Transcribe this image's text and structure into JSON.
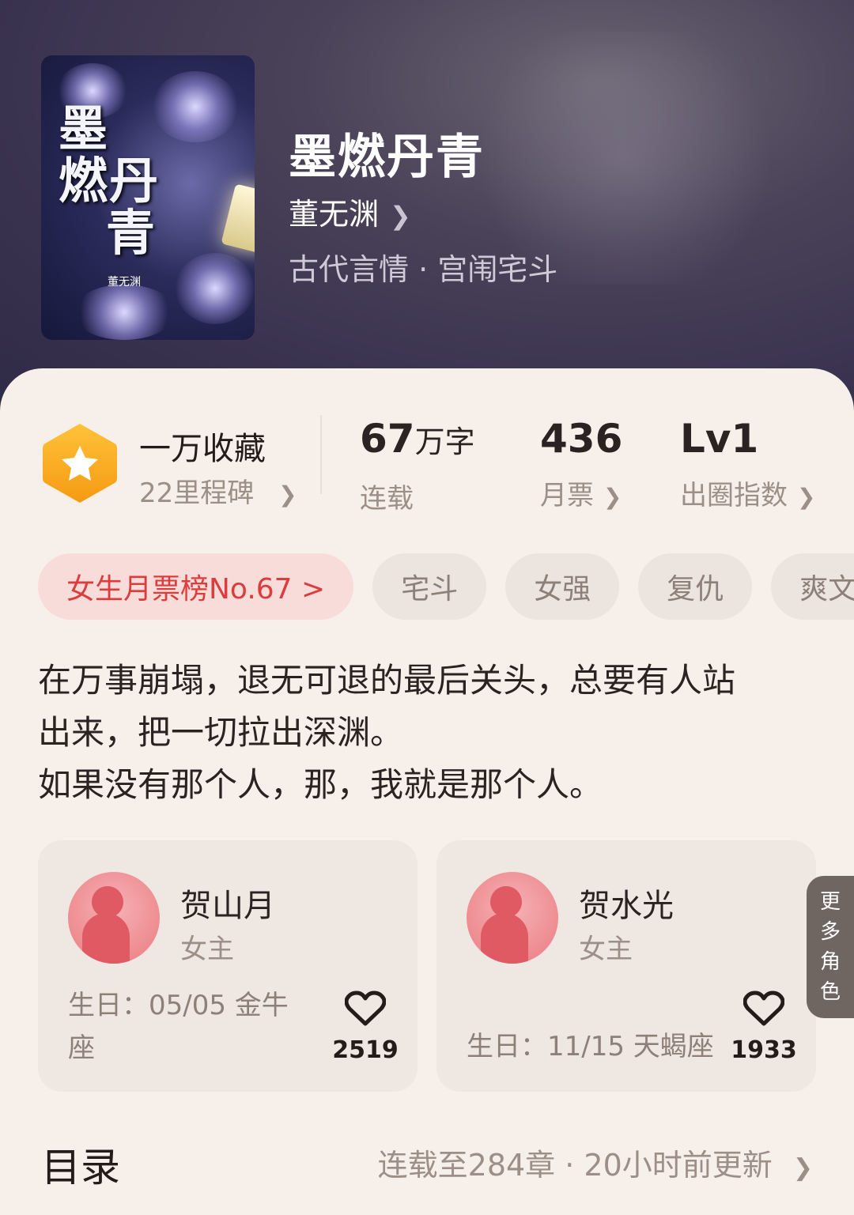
{
  "book": {
    "title": "墨燃丹青",
    "author": "董无渊",
    "genre": "古代言情 · 宫闱宅斗",
    "cover_title_lines": [
      "墨",
      "燃丹",
      "青"
    ],
    "cover_author": "董无渊"
  },
  "stats": {
    "collect_title": "一万收藏",
    "collect_sub": "22里程碑",
    "words_value": "67",
    "words_unit": "万字",
    "words_label": "连载",
    "tickets_value": "436",
    "tickets_label": "月票",
    "level_value": "Lv1",
    "level_label": "出圈指数"
  },
  "tags": [
    "女生月票榜No.67 >",
    "宅斗",
    "女强",
    "复仇",
    "爽文"
  ],
  "intro": {
    "line1": "在万事崩塌，退无可退的最后关头，总要有人站",
    "line2": "出来，把一切拉出深渊。",
    "line3": "如果没有那个人，那，我就是那个人。"
  },
  "characters": [
    {
      "name": "贺山月",
      "role": "女主",
      "birthday_line1": "生日：05/05 金牛",
      "birthday_line2": "座",
      "likes": "2519"
    },
    {
      "name": "贺水光",
      "role": "女主",
      "birthday": "生日：11/15 天蝎座",
      "likes": "1933"
    }
  ],
  "more_roles": [
    "更",
    "多",
    "角",
    "色"
  ],
  "toc": {
    "title": "目录",
    "info": "连载至284章 · 20小时前更新"
  },
  "colors": {
    "accent_red": "#dc3c3c",
    "badge_orange": "#f7a81b",
    "hero_bg": "#3a3350"
  },
  "icons": {
    "badge": "star-icon",
    "like": "heart-icon",
    "chevron": "chevron-right-icon"
  }
}
